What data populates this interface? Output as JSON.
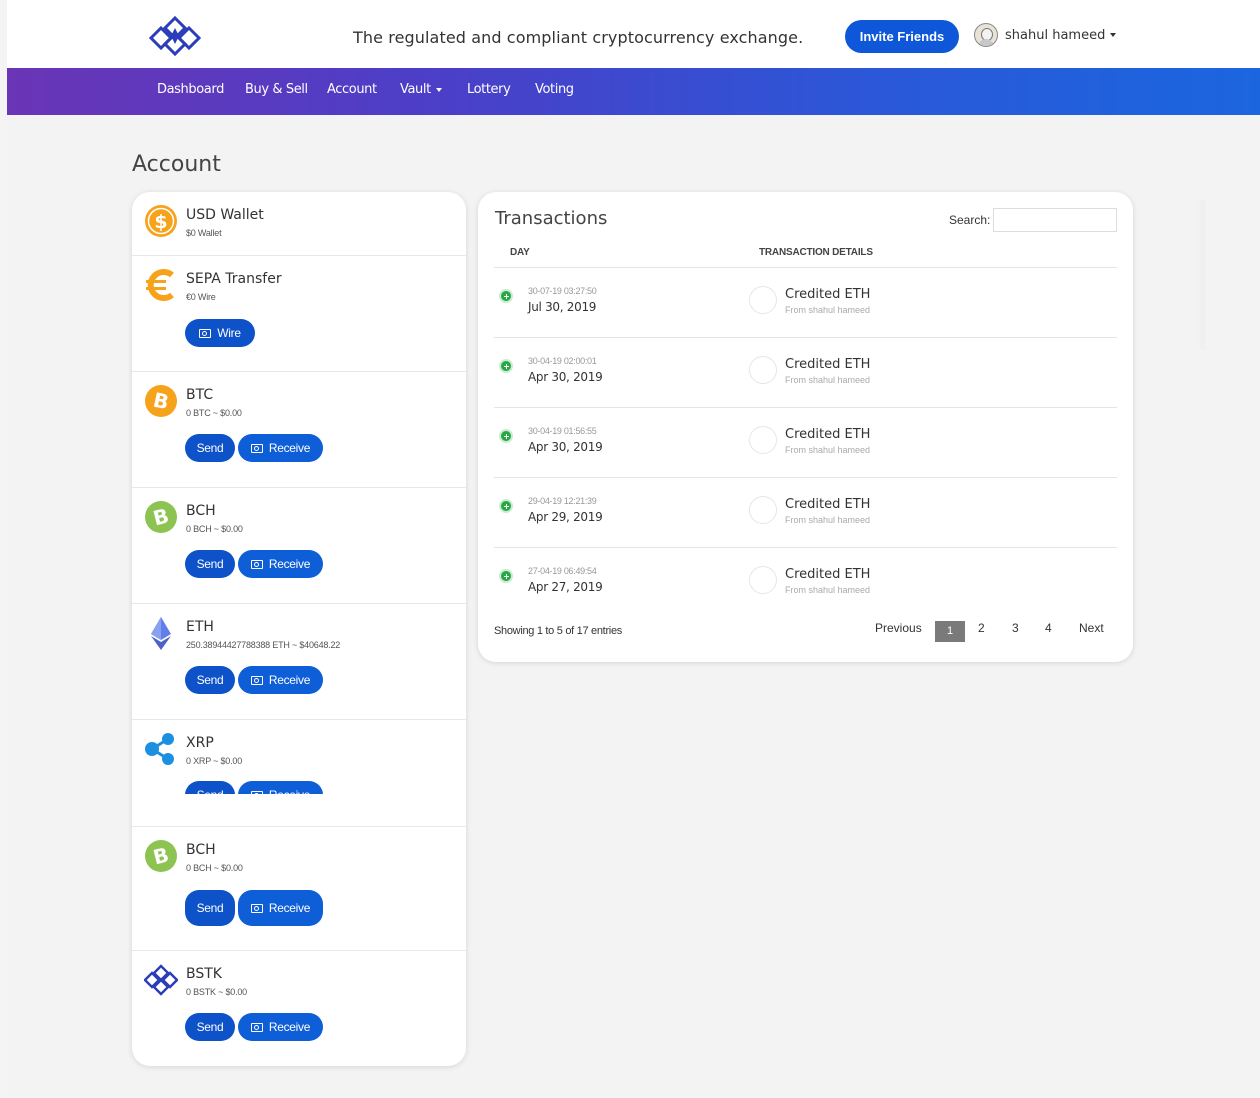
{
  "header": {
    "tagline": "The regulated and compliant cryptocurrency exchange.",
    "invite_label": "Invite Friends",
    "username": "shahul hameed"
  },
  "nav": {
    "items": [
      {
        "label": "Dashboard"
      },
      {
        "label": "Buy & Sell"
      },
      {
        "label": "Account"
      },
      {
        "label": "Vault"
      },
      {
        "label": "Lottery"
      },
      {
        "label": "Voting"
      }
    ]
  },
  "page": {
    "title": "Account"
  },
  "wallets": [
    {
      "name": "USD Wallet",
      "sub": "$0 Wallet",
      "icon": "dollar-coin-icon",
      "color": "#f7a21b"
    },
    {
      "name": "SEPA Transfer",
      "sub": "€0 Wire",
      "icon": "euro-icon",
      "color": "#f7a21b",
      "wire_label": "Wire"
    },
    {
      "name": "BTC",
      "sub": "0 BTC ~ $0.00",
      "icon": "bitcoin-icon",
      "color": "#f7a21b"
    },
    {
      "name": "BCH",
      "sub": "0 BCH ~ $0.00",
      "icon": "bitcoin-cash-icon",
      "color": "#8dc351"
    },
    {
      "name": "ETH",
      "sub": "250.38944427788388 ETH ~ $40648.22",
      "icon": "ethereum-icon",
      "color": "#627eea"
    },
    {
      "name": "XRP",
      "sub": "0 XRP ~ $0.00",
      "icon": "ripple-icon",
      "color": "#1d8fe1"
    },
    {
      "name": "BCH",
      "sub": "0 BCH ~ $0.00",
      "icon": "bitcoin-cash-icon",
      "color": "#8dc351"
    },
    {
      "name": "BSTK",
      "sub": "0 BSTK ~ $0.00",
      "icon": "bstk-logo-icon",
      "color": "#2b3db8"
    }
  ],
  "wallet_actions": {
    "send": "Send",
    "receive": "Receive"
  },
  "transactions": {
    "title": "Transactions",
    "search_label": "Search:",
    "col_day": "DAY",
    "col_details": "TRANSACTION DETAILS",
    "rows": [
      {
        "ts": "30-07-19 03:27:50",
        "date": "Jul 30, 2019",
        "detail": "Credited ETH",
        "from": "From shahul hameed"
      },
      {
        "ts": "30-04-19 02:00:01",
        "date": "Apr 30, 2019",
        "detail": "Credited ETH",
        "from": "From shahul hameed"
      },
      {
        "ts": "30-04-19 01:56:55",
        "date": "Apr 30, 2019",
        "detail": "Credited ETH",
        "from": "From shahul hameed"
      },
      {
        "ts": "29-04-19 12:21:39",
        "date": "Apr 29, 2019",
        "detail": "Credited ETH",
        "from": "From shahul hameed"
      },
      {
        "ts": "27-04-19 06:49:54",
        "date": "Apr 27, 2019",
        "detail": "Credited ETH",
        "from": "From shahul hameed"
      }
    ],
    "info": "Showing 1 to 5 of 17 entries",
    "pager": {
      "previous": "Previous",
      "pages": [
        "1",
        "2",
        "3",
        "4"
      ],
      "next": "Next",
      "active": "1"
    }
  }
}
